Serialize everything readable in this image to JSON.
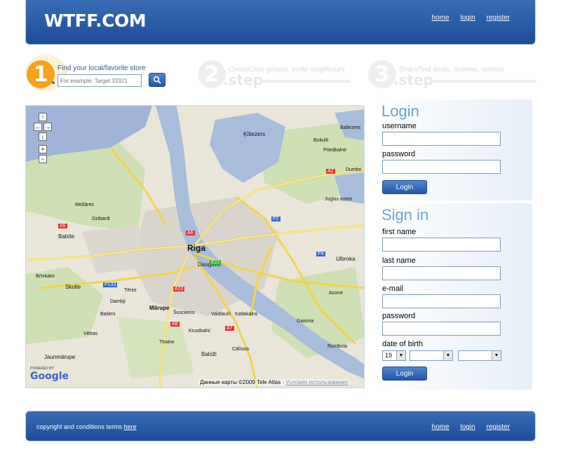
{
  "header": {
    "logo": "WTFF.COM",
    "nav": {
      "home": "home",
      "login": "login",
      "register": "register"
    }
  },
  "steps": {
    "step1": {
      "number": "1",
      "caption": "Find your local/favorite store",
      "placeholder": "For example: Target 33321"
    },
    "step2": {
      "number": "2",
      "caption": "Create/Join groups, invite neighbours",
      "step_label": ".step"
    },
    "step3": {
      "number": "3",
      "caption": "Share/find deals, reviews, options",
      "step_label": ".step"
    }
  },
  "map": {
    "city": "Riga",
    "labels": {
      "daugava": "Daugava",
      "kisezers": "Ķīšezers",
      "babite": "Babīte",
      "marupe": "Mārupe",
      "skulte": "Skulte",
      "jaunmarupe": "Jaunmārupe",
      "balozi": "Baloži",
      "ulbroka": "Ulbroka",
      "dzibardi": "Dzibardi",
      "mezares": "Mežāres",
      "vetras": "Vētras",
      "acone": "Acone",
      "gaisma": "Gaisma",
      "rumbula": "Rumbula",
      "kekava": "Katlakalns",
      "dumbri": "Dumbri",
      "jugla": "Juglas ezers",
      "bukulti": "Bukulti",
      "baltezers": "Baltezers",
      "priedkalne": "Priedkalne",
      "tilraine": "Tīraine",
      "brivkalni": "Brīvkalni",
      "socisems": "Šosciems",
      "krustkalni": "Krustkalni",
      "valdlauci": "Valdlauči",
      "dambji": "Dambji",
      "basieni": "Bašeni",
      "rites": "Tēriņi",
      "calssis": "Cālīssis"
    },
    "roads": [
      "A5",
      "A6",
      "A2",
      "A10",
      "A8",
      "A7",
      "E22",
      "P2",
      "P4",
      "P133"
    ],
    "powered": "POWERED BY",
    "google": "Google",
    "copyright": "Данные карты ©2009 Tele Atlas -",
    "terms": "Условия использования"
  },
  "login": {
    "title": "Login",
    "username_label": "username",
    "password_label": "password",
    "button": "Login"
  },
  "signin": {
    "title": "Sign in",
    "first_name_label": "first name",
    "last_name_label": "last name",
    "email_label": "e-mail",
    "password_label": "password",
    "dob_label": "date of birth",
    "dob_day": "19",
    "dob_month": "",
    "dob_year": "",
    "button": "Login"
  },
  "footer": {
    "text": "copyright and conditions terms",
    "link": "here",
    "nav": {
      "home": "home",
      "login": "login",
      "register": "register"
    }
  },
  "colors": {
    "brand_blue": "#1d4c98",
    "step_orange": "#f6a21a",
    "heading_blue": "#6aa4d8"
  }
}
